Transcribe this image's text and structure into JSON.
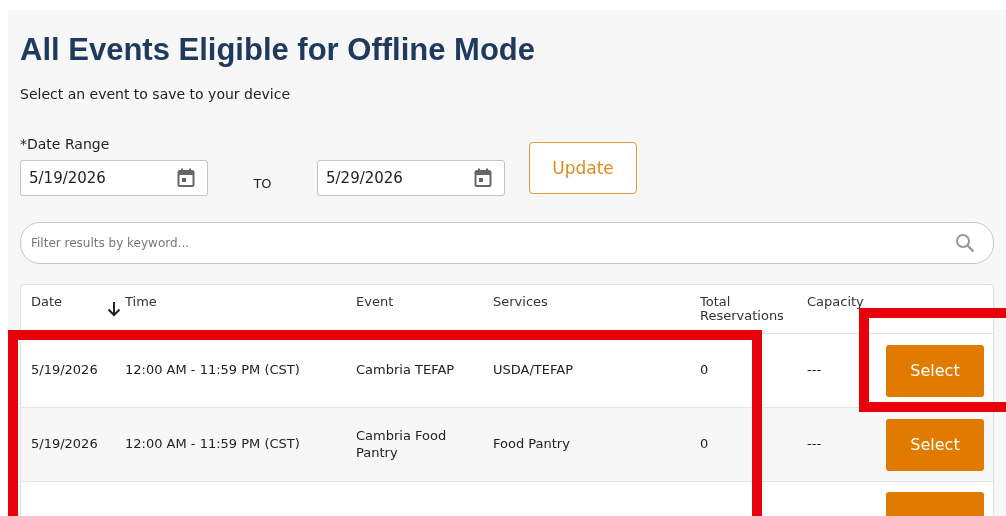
{
  "title": "All Events Eligible for Offline Mode",
  "subtitle": "Select an event to save to your device",
  "date_range": {
    "label": "*Date Range",
    "from": "5/19/2026",
    "separator": "TO",
    "to": "5/29/2026",
    "button": "Update"
  },
  "search": {
    "placeholder": "Filter results by keyword..."
  },
  "table": {
    "columns": [
      {
        "label": "Date",
        "sorted": true
      },
      {
        "label": "Time",
        "sorted": false
      },
      {
        "label": "Event",
        "sorted": false
      },
      {
        "label": "Services",
        "sorted": false
      },
      {
        "label": "Total Reservations",
        "sorted": false
      },
      {
        "label": "Capacity",
        "sorted": false
      }
    ],
    "rows": [
      {
        "date": "5/19/2026",
        "time": "12:00 AM - 11:59 PM (CST)",
        "event": "Cambria TEFAP",
        "services": "USDA/TEFAP",
        "total": "0",
        "capacity": "---",
        "action": "Select",
        "action_highlighted": true
      },
      {
        "date": "5/19/2026",
        "time": "12:00 AM - 11:59 PM (CST)",
        "event": "Cambria Food Pantry",
        "services": "Food Pantry",
        "total": "0",
        "capacity": "---",
        "action": "Select",
        "action_highlighted": false
      }
    ],
    "rows_highlighted": true,
    "more_rows_below": true
  }
}
